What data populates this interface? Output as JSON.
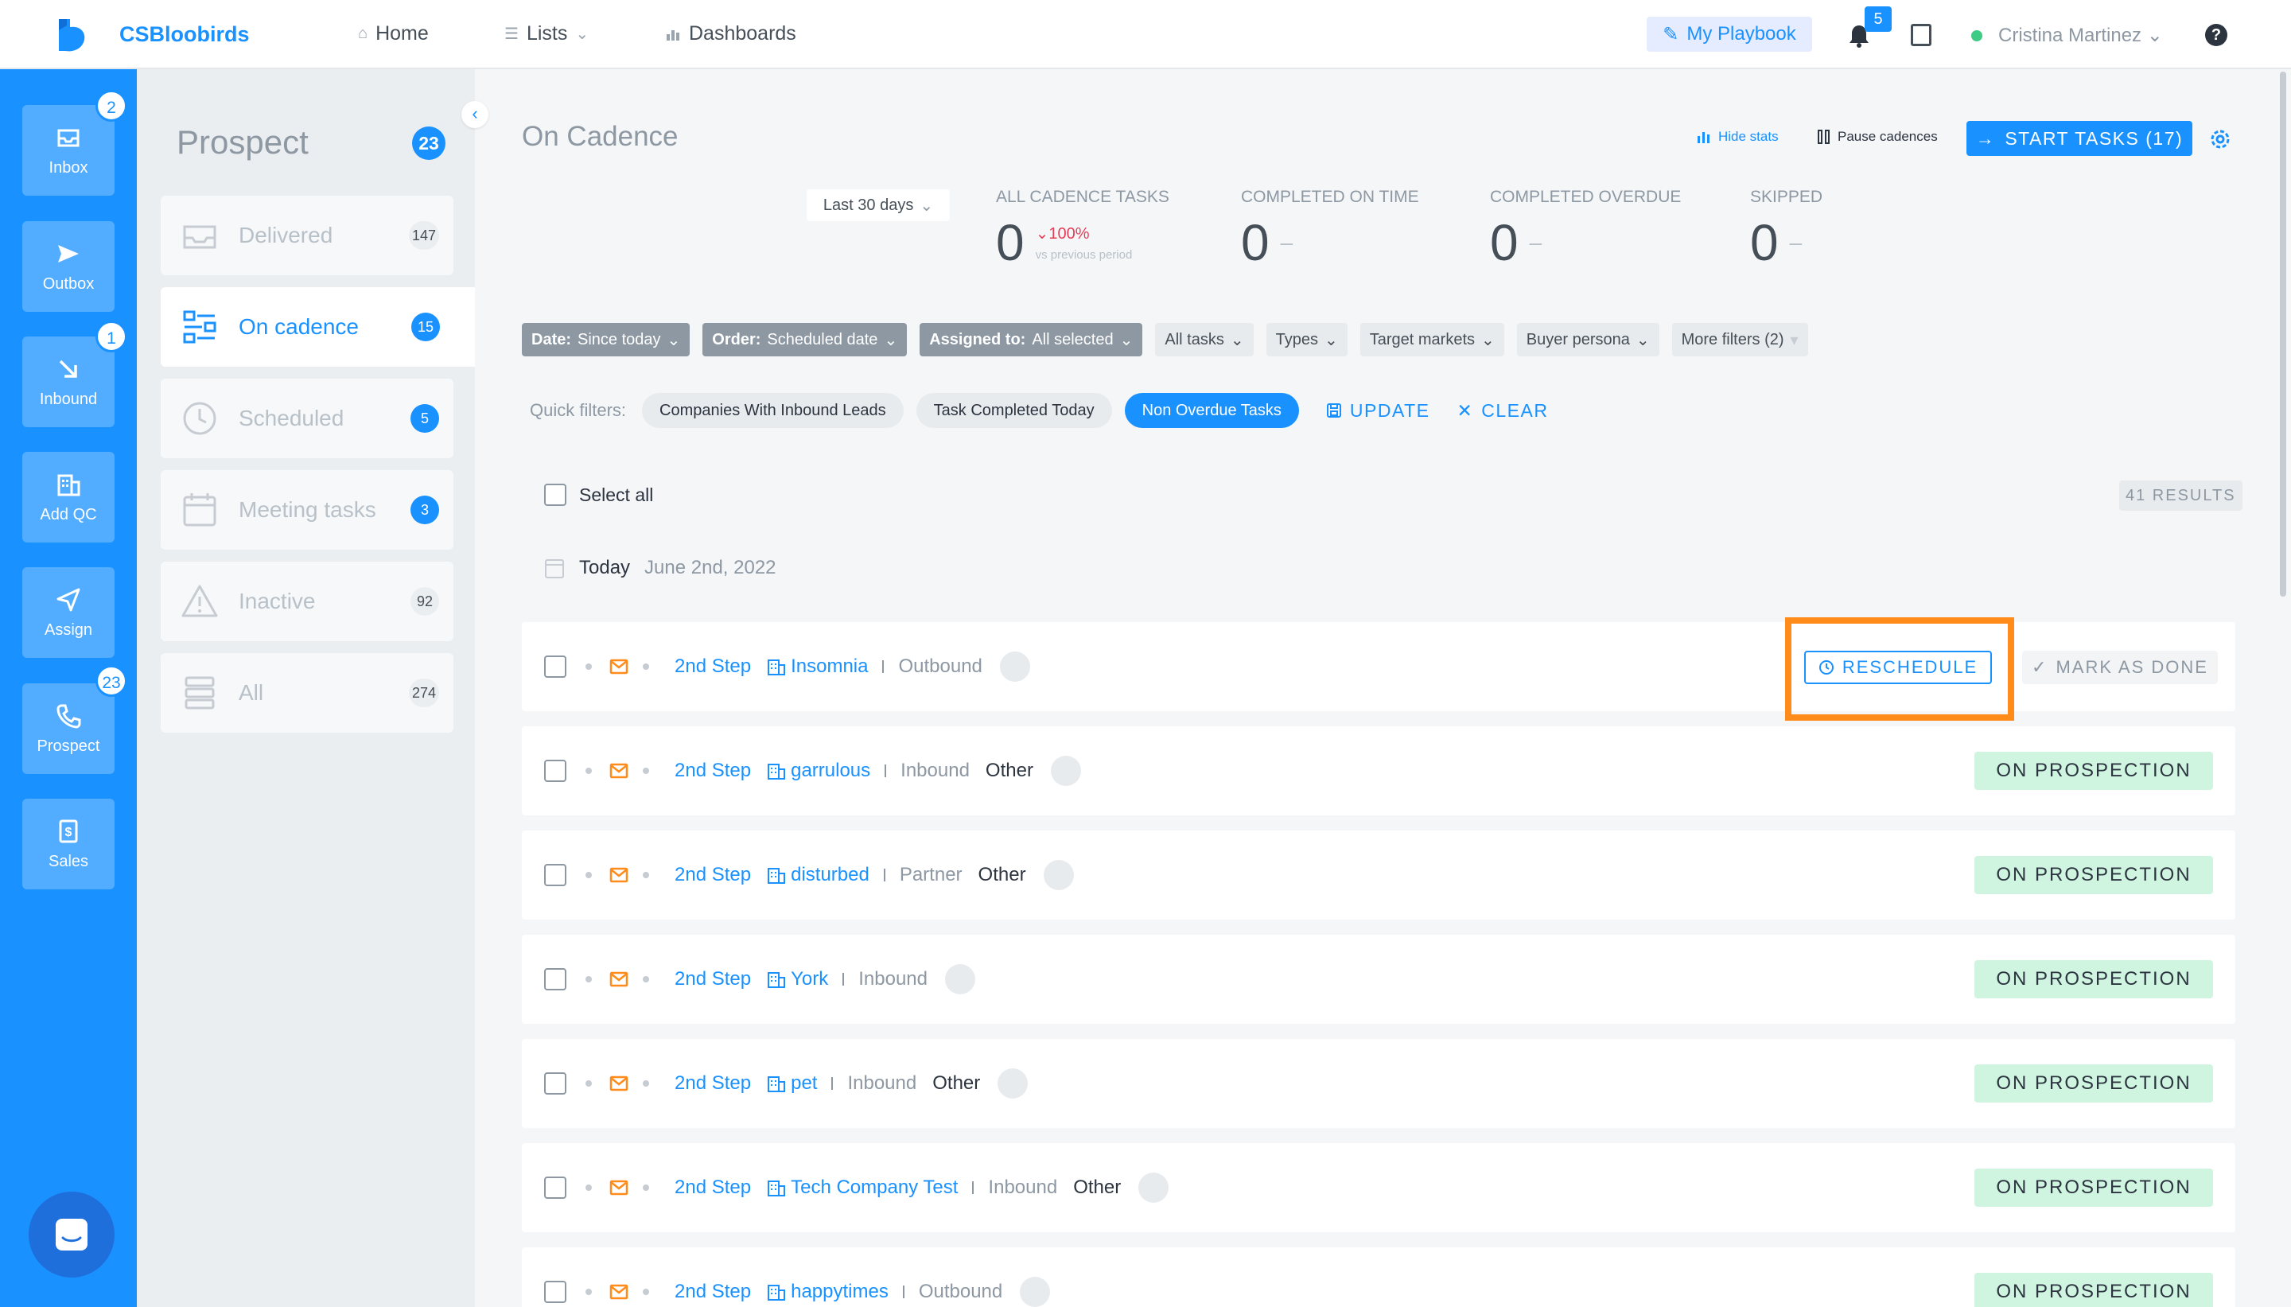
{
  "brand": {
    "name": "CSBloobirds"
  },
  "nav": {
    "home": "Home",
    "lists": "Lists",
    "dashboards": "Dashboards",
    "playbook": "My Playbook",
    "notifications_count": "5",
    "user_name": "Cristina Martinez",
    "help": "?"
  },
  "rail": {
    "items": [
      {
        "label": "Inbox",
        "icon": "inbox-icon",
        "badge": "2"
      },
      {
        "label": "Outbox",
        "icon": "send-icon",
        "badge": ""
      },
      {
        "label": "Inbound",
        "icon": "arrow-down-right-icon",
        "badge": "1"
      },
      {
        "label": "Add QC",
        "icon": "building-add-icon",
        "badge": ""
      },
      {
        "label": "Assign",
        "icon": "paper-plane-icon",
        "badge": ""
      },
      {
        "label": "Prospect",
        "icon": "phone-icon",
        "badge": "23"
      },
      {
        "label": "Sales",
        "icon": "dollar-icon",
        "badge": ""
      }
    ]
  },
  "subnav": {
    "title": "Prospect",
    "count": "23",
    "items": [
      {
        "label": "Delivered",
        "count": "147"
      },
      {
        "label": "On cadence",
        "count": "15"
      },
      {
        "label": "Scheduled",
        "count": "5"
      },
      {
        "label": "Meeting tasks",
        "count": "3"
      },
      {
        "label": "Inactive",
        "count": "92"
      },
      {
        "label": "All",
        "count": "274"
      }
    ]
  },
  "main": {
    "title": "On Cadence",
    "hide_stats": "Hide stats",
    "pause_cadences": "Pause cadences",
    "start_tasks": "START TASKS (17)"
  },
  "stats": {
    "period": "Last 30 days",
    "items": [
      {
        "label": "ALL CADENCE TASKS",
        "value": "0",
        "delta": "100%",
        "vs": "vs previous period"
      },
      {
        "label": "COMPLETED ON TIME",
        "value": "0",
        "dash": "–"
      },
      {
        "label": "COMPLETED OVERDUE",
        "value": "0",
        "dash": "–"
      },
      {
        "label": "SKIPPED",
        "value": "0",
        "dash": "–"
      }
    ]
  },
  "filters": {
    "date_key": "Date:",
    "date_val": "Since today",
    "order_key": "Order:",
    "order_val": "Scheduled date",
    "assigned_key": "Assigned to:",
    "assigned_val": "All selected",
    "all_tasks": "All tasks",
    "types": "Types",
    "target_markets": "Target markets",
    "buyer_persona": "Buyer persona",
    "more_filters": "More filters (2)"
  },
  "quick_filters": {
    "label": "Quick filters:",
    "chips": [
      "Companies With Inbound Leads",
      "Task Completed Today",
      "Non Overdue Tasks"
    ],
    "update": "UPDATE",
    "clear": "CLEAR"
  },
  "list": {
    "select_all": "Select all",
    "results": "41 RESULTS",
    "today_label": "Today",
    "today_date": "June 2nd, 2022",
    "reschedule": "RESCHEDULE",
    "mark_done": "MARK AS DONE",
    "on_prospection": "ON PROSPECTION",
    "rows": [
      {
        "step": "2nd Step",
        "company": "Insomnia",
        "source": "Outbound",
        "extra": ""
      },
      {
        "step": "2nd Step",
        "company": "garrulous",
        "source": "Inbound",
        "extra": "Other"
      },
      {
        "step": "2nd Step",
        "company": "disturbed",
        "source": "Partner",
        "extra": "Other"
      },
      {
        "step": "2nd Step",
        "company": "York",
        "source": "Inbound",
        "extra": ""
      },
      {
        "step": "2nd Step",
        "company": "pet",
        "source": "Inbound",
        "extra": "Other"
      },
      {
        "step": "2nd Step",
        "company": "Tech Company Test",
        "source": "Inbound",
        "extra": "Other"
      },
      {
        "step": "2nd Step",
        "company": "happytimes",
        "source": "Outbound",
        "extra": ""
      }
    ]
  },
  "colors": {
    "accent": "#1991ff",
    "highlight": "#ff8c1a",
    "prospection": "#cff5e0",
    "negative": "#e43f58"
  }
}
